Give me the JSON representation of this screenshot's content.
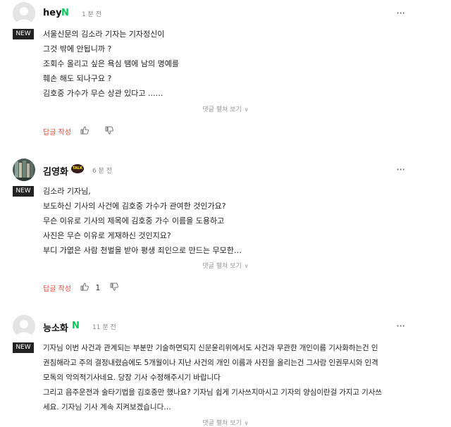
{
  "ui": {
    "reply_label": "답글 작성",
    "expand_label": "댓글 펼쳐 보기",
    "new_label": "NEW",
    "more_label": "···",
    "n_badge": "N",
    "talk_badge": "TALK",
    "colors": {
      "naver_green": "#03c75a",
      "reply_red": "#e74c3c",
      "new_bg": "#222222"
    }
  },
  "comments": [
    {
      "author": "hey",
      "badge": "N",
      "time": "1 분 전",
      "is_new": true,
      "lines": [
        "서울신문의 김소라 기자는 기자정신이",
        "그것 밖에 안됩니까 ?",
        "조회수 올리고 싶은 욕심 땜에 남의 명예를",
        "훼손 해도 되나구요 ?",
        "김호중 가수가 무슨 상관 있다고 ...…"
      ],
      "likes": ""
    },
    {
      "author": "김영화",
      "badge": "TALK",
      "time": "6 분 전",
      "is_new": true,
      "lines": [
        "김소라 기자님,",
        "보도하신 기사의 사건에 김호중 가수가 관여한 것인가요?",
        "무슨 이유로 기사의 제목에 김호중 가수 이름을 도용하고",
        "사진은 무슨 이유로 게재하신 것인지요?",
        "부디 가엾은 사람 천벌을 받아 평생 죄인으로 만드는 무모한…"
      ],
      "likes": "1"
    },
    {
      "author": "능소화",
      "badge": "N",
      "time": "11 분 전",
      "is_new": true,
      "lines": [
        "기자님 이번 사건과 관계되는 부분만 기술하면되지 신문윤리위에서도 사건과 무관한 개인이름 기사화하는건 인",
        "권침해라고 주의 결정내렸슴에도 5개월이나 지난 사건의 개인 이름과 사진을 올리는건 그사람 인권무시와 인격",
        "모독의 악의적기사네요. 당장 기사 수정해주시기 바랍니다",
        "그리고 음주운전과 술타기법을 김호중만 했나요? 기자님 쉽게 기사쓰지마시고 기자의 양심이란걸 가지고 기사쓰",
        "세요. 기자님 기사 계속 지켜보겠습니다…"
      ],
      "likes": ""
    }
  ]
}
